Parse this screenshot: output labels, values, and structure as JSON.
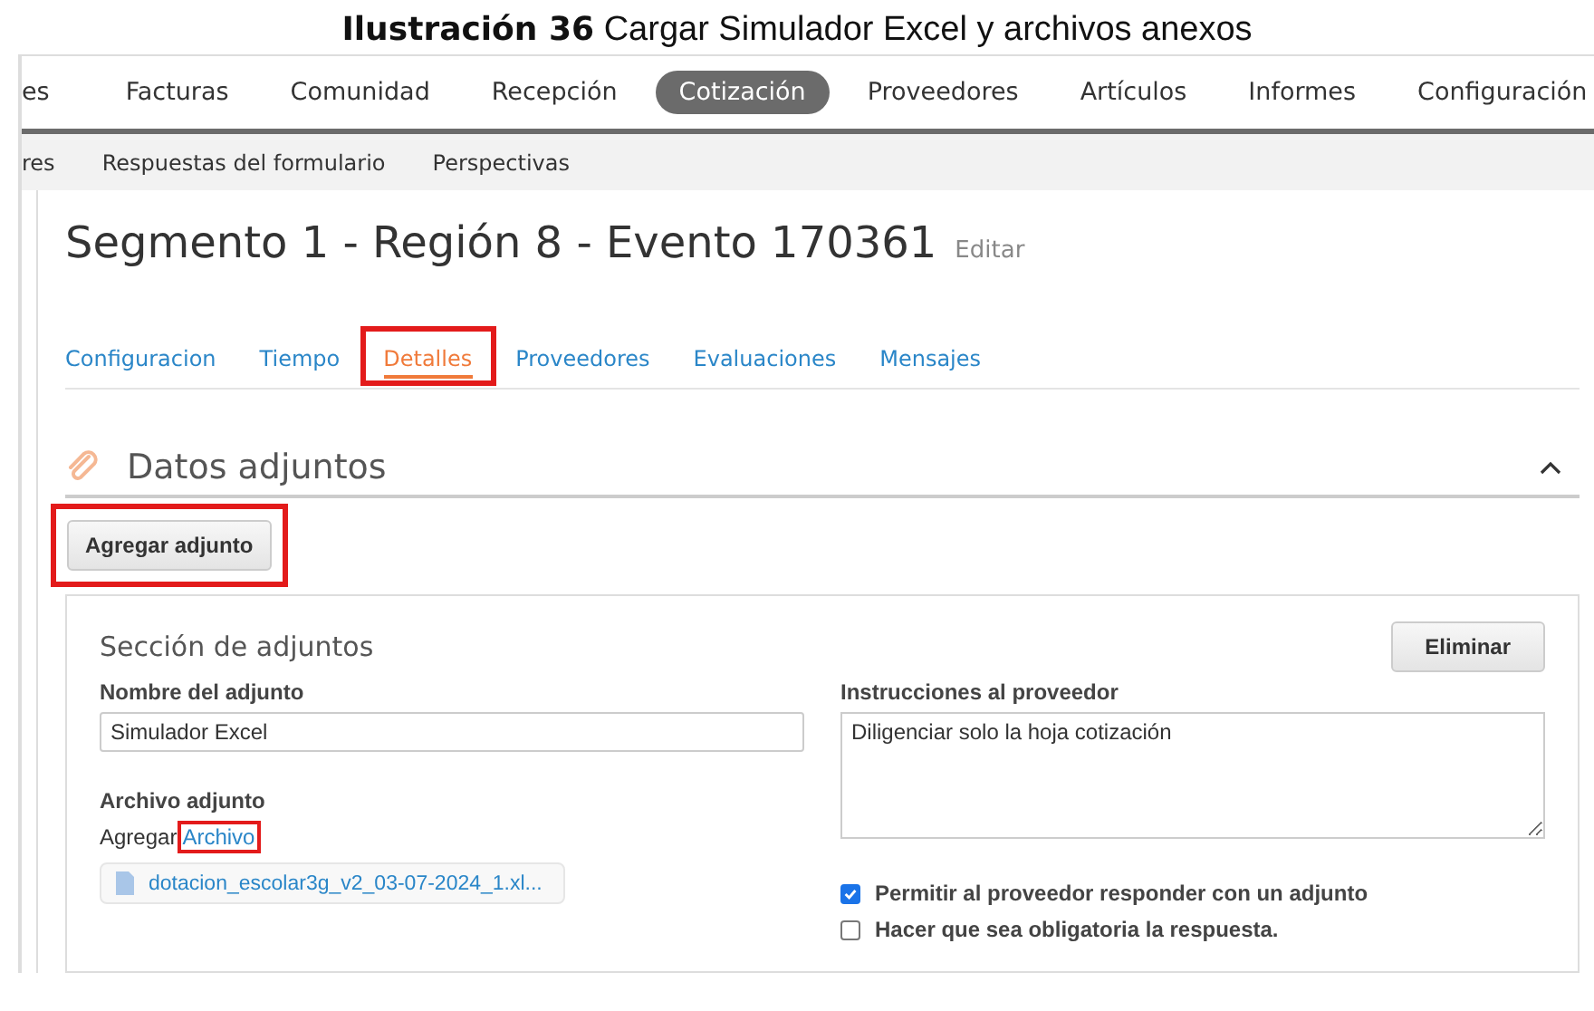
{
  "caption": {
    "label": "Ilustración 36",
    "text": "Cargar Simulador Excel y archivos anexos"
  },
  "nav": [
    {
      "label": "es",
      "selected": false
    },
    {
      "label": "Facturas",
      "selected": false
    },
    {
      "label": "Comunidad",
      "selected": false
    },
    {
      "label": "Recepción",
      "selected": false
    },
    {
      "label": "Cotización",
      "selected": true
    },
    {
      "label": "Proveedores",
      "selected": false
    },
    {
      "label": "Artículos",
      "selected": false
    },
    {
      "label": "Informes",
      "selected": false
    },
    {
      "label": "Configuración",
      "selected": false
    }
  ],
  "subnav": [
    "res",
    "Respuestas del formulario",
    "Perspectivas"
  ],
  "title": "Segmento 1 - Región 8 - Evento 170361",
  "edit_link": "Editar",
  "tabs": [
    {
      "label": "Configuracion",
      "selected": false,
      "highlighted": false
    },
    {
      "label": "Tiempo",
      "selected": false,
      "highlighted": false
    },
    {
      "label": "Detalles",
      "selected": true,
      "highlighted": true
    },
    {
      "label": "Proveedores",
      "selected": false,
      "highlighted": false
    },
    {
      "label": "Evaluaciones",
      "selected": false,
      "highlighted": false
    },
    {
      "label": "Mensajes",
      "selected": false,
      "highlighted": false
    }
  ],
  "section": {
    "title": "Datos adjuntos",
    "expanded": true
  },
  "add_button": {
    "label": "Agregar adjunto",
    "highlighted": true
  },
  "card": {
    "title": "Sección de adjuntos",
    "delete_button": "Eliminar",
    "name_label": "Nombre del adjunto",
    "name_value": "Simulador Excel",
    "file_label": "Archivo adjunto",
    "add_text": "Agregar",
    "file_link": {
      "label": "Archivo",
      "highlighted": true
    },
    "file_name": "dotacion_escolar3g_v2_03-07-2024_1.xl...",
    "instructions_label": "Instrucciones al proveedor",
    "instructions_value": "Diligenciar solo la hoja cotización",
    "options": [
      {
        "label": "Permitir al proveedor responder con un adjunto",
        "checked": true
      },
      {
        "label": "Hacer que sea obligatoria la respuesta.",
        "checked": false
      }
    ]
  }
}
